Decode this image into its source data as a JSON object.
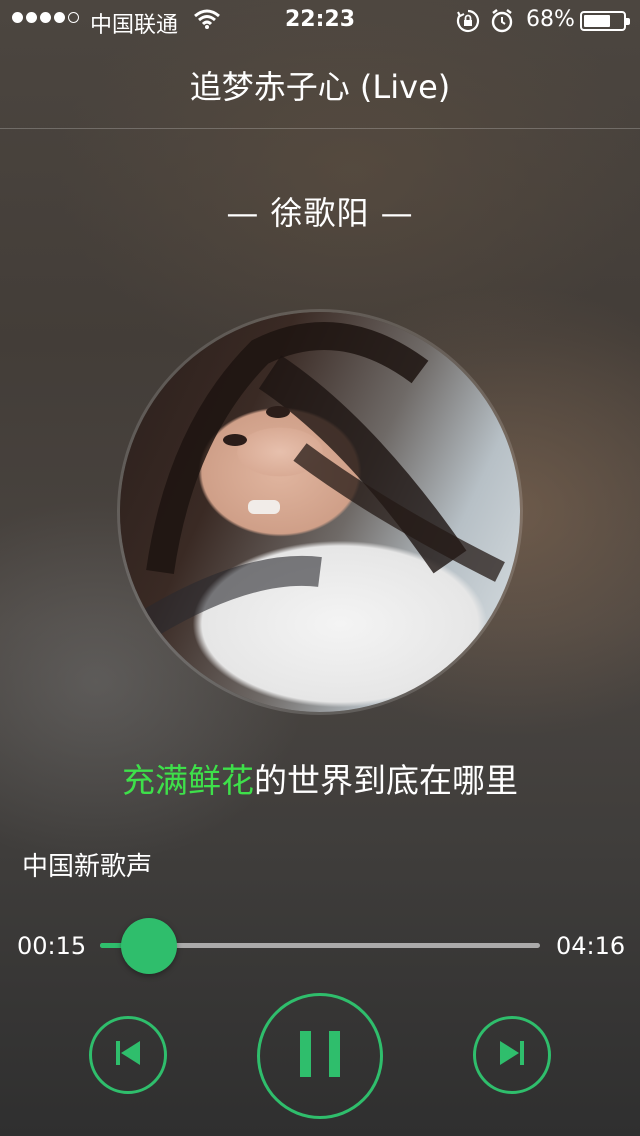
{
  "status_bar": {
    "carrier": "中国联通",
    "time": "22:23",
    "battery_percent": "68%",
    "battery_level": 0.68,
    "signal_bars_filled": 4,
    "signal_bars_total": 5
  },
  "player": {
    "song_title": "追梦赤子心 (Live)",
    "artist_line": "— 徐歌阳 —",
    "lyric_highlight": "充满鲜花",
    "lyric_rest": "的世界到底在哪里",
    "album_name": "中国新歌声",
    "current_time": "00:15",
    "total_time": "04:16",
    "progress": 0.06
  },
  "icons": {
    "wifi": "wifi-icon",
    "lock": "rotation-lock-icon",
    "alarm": "alarm-icon",
    "battery": "battery-icon",
    "prev": "skip-previous-icon",
    "pause": "pause-icon",
    "next": "skip-next-icon"
  },
  "colors": {
    "accent": "#2fbe6c",
    "lyric_highlight": "#3ee04a"
  }
}
